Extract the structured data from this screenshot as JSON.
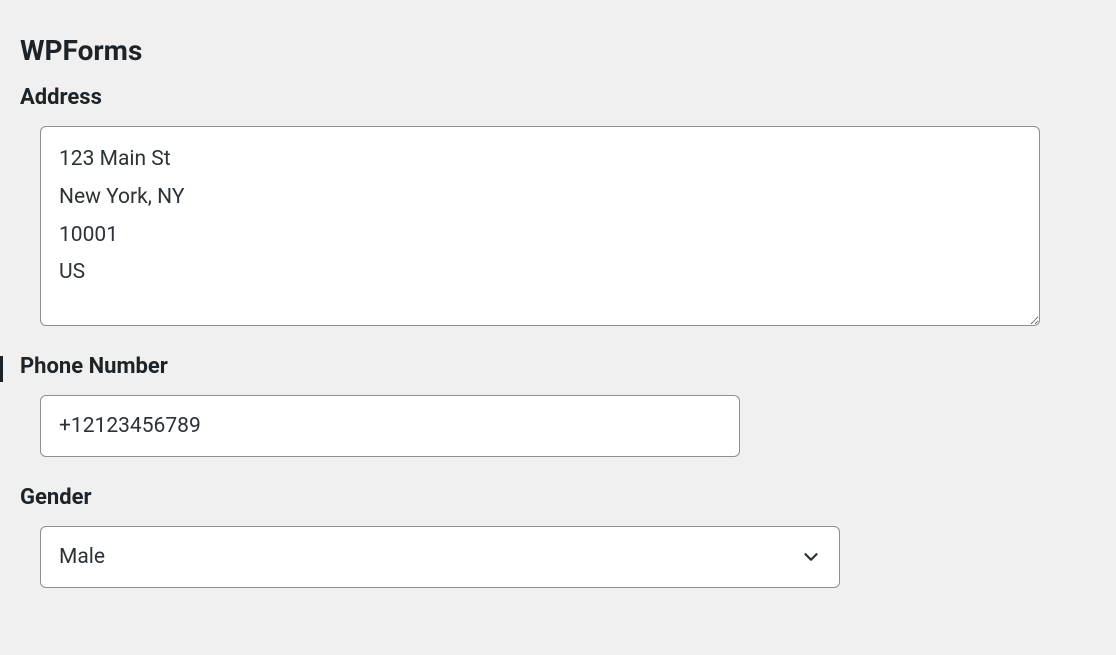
{
  "section_title": "WPForms",
  "fields": {
    "address": {
      "label": "Address",
      "value": "123 Main St\nNew York, NY\n10001\nUS"
    },
    "phone": {
      "label": "Phone Number",
      "value": "+12123456789"
    },
    "gender": {
      "label": "Gender",
      "selected": "Male"
    }
  }
}
